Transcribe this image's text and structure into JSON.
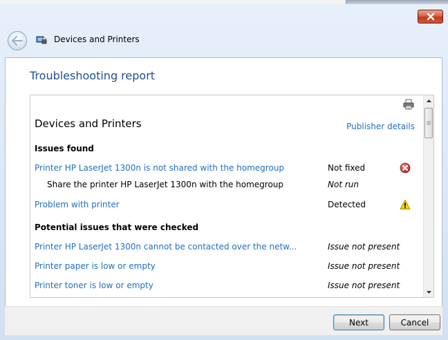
{
  "window": {
    "title": "Devices and Printers"
  },
  "page": {
    "heading": "Troubleshooting report"
  },
  "report": {
    "title": "Devices and Printers",
    "publisher_link": "Publisher details",
    "issues_found_label": "Issues found",
    "issues_found": [
      {
        "name": "Printer HP LaserJet 1300n is not shared with the homegroup",
        "status": "Not fixed",
        "icon": "error-icon",
        "link": true
      },
      {
        "name": "Share the printer HP LaserJet 1300n with the homegroup",
        "status": "Not run",
        "icon": "",
        "link": false
      },
      {
        "name": "Problem with printer",
        "status": "Detected",
        "icon": "warning-icon",
        "link": true
      }
    ],
    "potential_label": "Potential issues that were checked",
    "potential_issues": [
      {
        "name": "Printer HP LaserJet 1300n cannot be contacted over the netw...",
        "status": "Issue not present"
      },
      {
        "name": "Printer paper is low or empty",
        "status": "Issue not present"
      },
      {
        "name": "Printer toner is low or empty",
        "status": "Issue not present"
      }
    ]
  },
  "footer": {
    "next_label": "Next",
    "cancel_label": "Cancel"
  },
  "colors": {
    "link": "#1f6fc1",
    "heading": "#1f4e96",
    "close_button": "#c2391d"
  }
}
